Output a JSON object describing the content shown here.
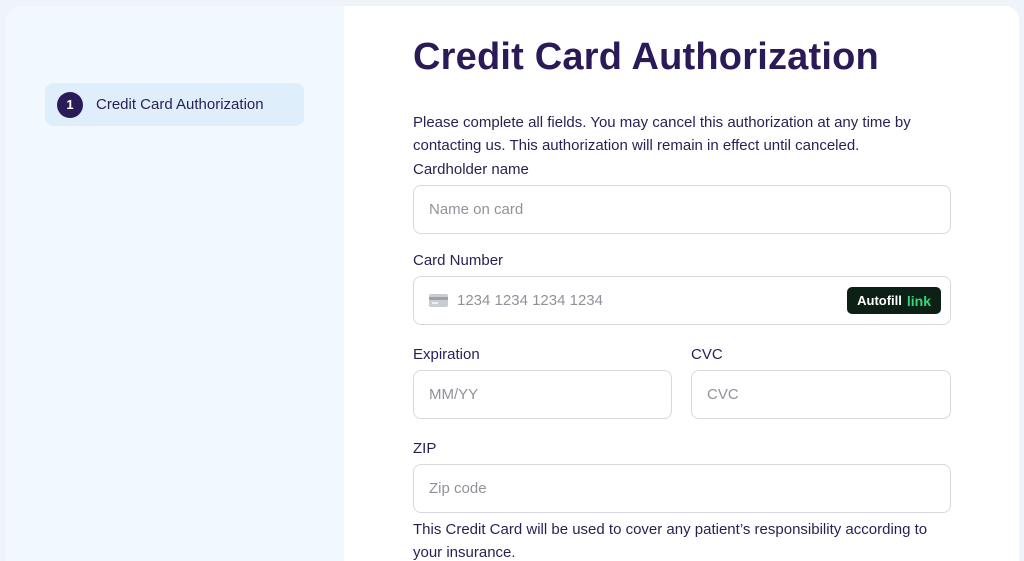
{
  "sidebar": {
    "steps": [
      {
        "number": "1",
        "label": "Credit Card Authorization",
        "active": true
      }
    ]
  },
  "form": {
    "title": "Credit Card Authorization",
    "intro": "Please complete all fields. You may cancel this authorization at any time by contacting us. This authorization will remain in effect until canceled.",
    "cardholder": {
      "label": "Cardholder name",
      "placeholder": "Name on card",
      "value": ""
    },
    "card_number": {
      "label": "Card Number",
      "placeholder": "1234 1234 1234 1234",
      "value": "",
      "icon": "credit-card-icon",
      "autofill_text": "Autofill",
      "autofill_link": "link"
    },
    "expiration": {
      "label": "Expiration",
      "placeholder": "MM/YY",
      "value": ""
    },
    "cvc": {
      "label": "CVC",
      "placeholder": "CVC",
      "value": ""
    },
    "zip": {
      "label": "ZIP",
      "placeholder": "Zip code",
      "value": ""
    },
    "footer_note": "This Credit Card will be used to cover any patient’s responsibility according to your insurance."
  },
  "colors": {
    "primary": "#2a1a57",
    "sidebar_bg": "#f2f9fe",
    "step_bg": "#deeefb",
    "autofill_bg": "#0d2015",
    "link_green": "#33d67a"
  }
}
